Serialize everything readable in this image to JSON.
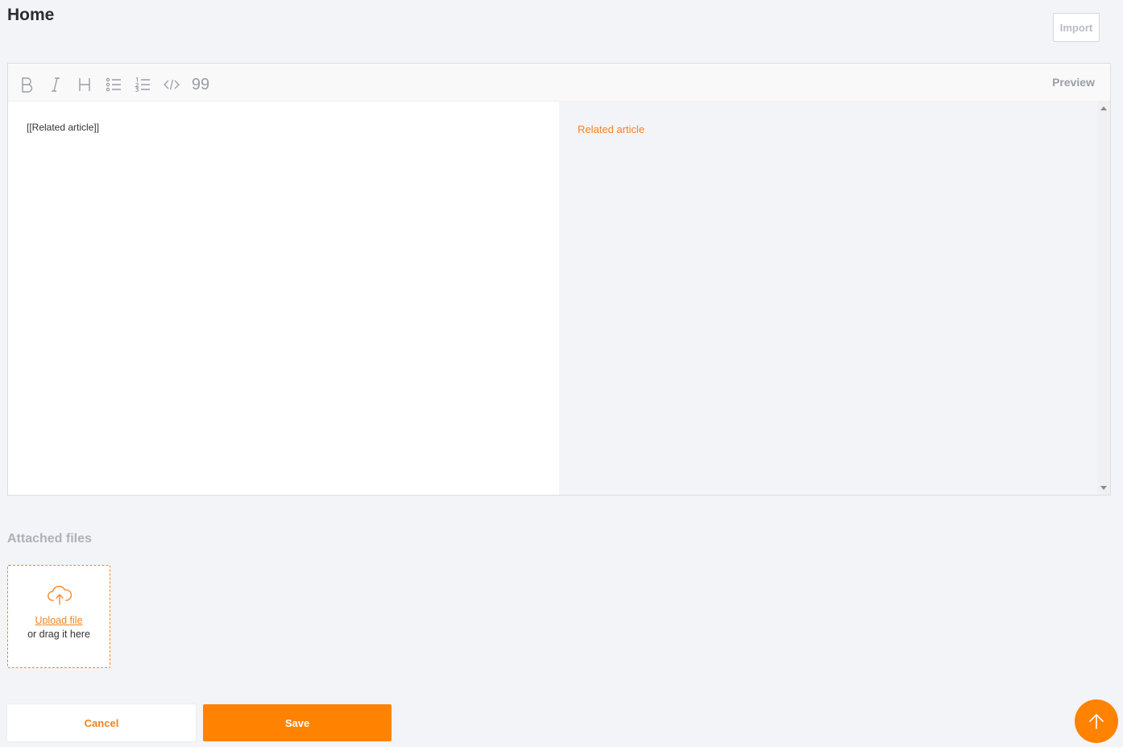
{
  "header": {
    "title": "Home",
    "import_label": "Import"
  },
  "editor": {
    "toolbar": {
      "tools": [
        "bold",
        "italic",
        "heading",
        "bullet-list",
        "numbered-list",
        "code",
        "quote"
      ],
      "quote_glyph": "99",
      "preview_label": "Preview"
    },
    "source_text": "[[Related article]]",
    "preview_link_text": "Related article"
  },
  "attachments": {
    "title": "Attached files",
    "upload_label": "Upload file",
    "drag_label": "or drag it here"
  },
  "actions": {
    "cancel_label": "Cancel",
    "save_label": "Save"
  },
  "colors": {
    "accent": "#ff8200",
    "link": "#f5821f",
    "background": "#f3f4f7"
  },
  "icons": {
    "upload": "cloud-upload-icon",
    "scroll_top": "arrow-up-icon"
  }
}
